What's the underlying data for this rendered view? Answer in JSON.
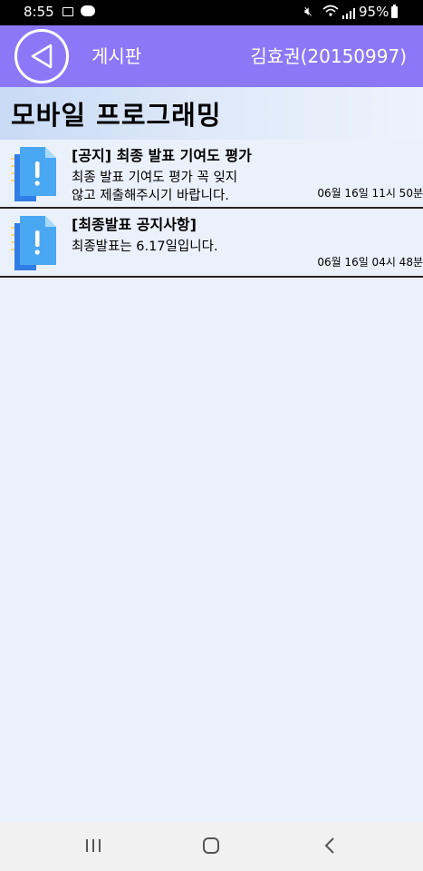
{
  "status_bar": {
    "time": "8:55",
    "battery": "95%",
    "icons": [
      "image-icon",
      "talk-icon",
      "mute-icon",
      "wifi-icon",
      "signal-icon",
      "battery-icon"
    ]
  },
  "header": {
    "board_label": "게시판",
    "user_label": "김효권(20150997)",
    "accent_color": "#8c78f7"
  },
  "course": {
    "title": "모바일 프로그래밍"
  },
  "posts": [
    {
      "title": "[공지] 최종 발표 기여도 평가",
      "body_line1": "최종 발표 기여도 평가 꼭 잊지",
      "body_line2": "않고 제출해주시기 바랍니다.",
      "date": "06월 16일 11시 50분"
    },
    {
      "title": "[최종발표 공지사항]",
      "body_line1": "최종발표는 6.17일입니다.",
      "body_line2": "",
      "date": "06월 16일 04시 48분"
    }
  ],
  "nav": {
    "icons": [
      "recent-apps-icon",
      "home-icon",
      "back-icon"
    ]
  }
}
